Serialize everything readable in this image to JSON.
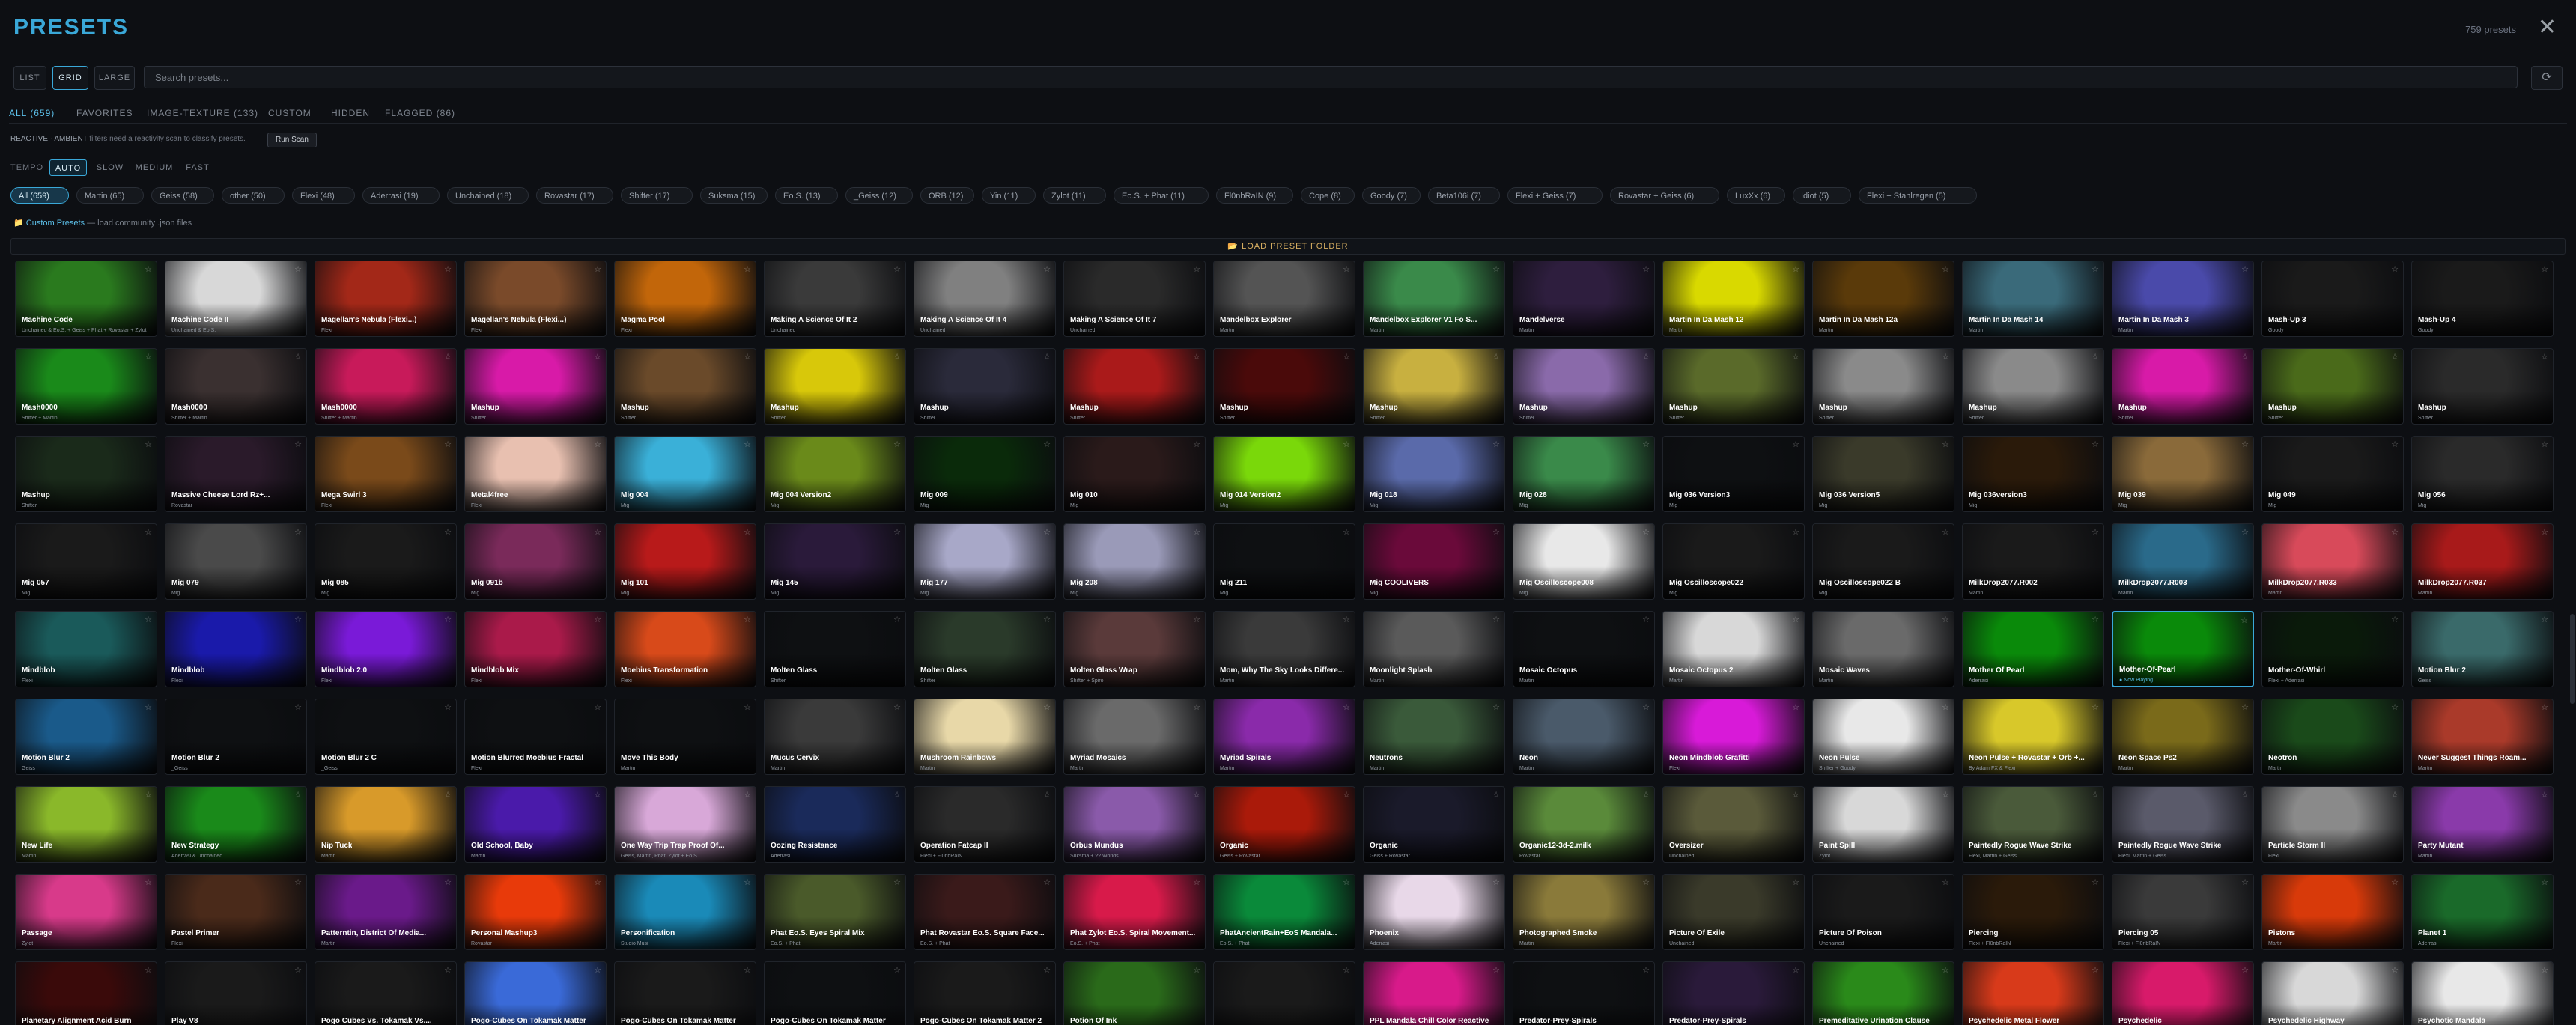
{
  "header": {
    "title": "PRESETS",
    "count": "759 presets",
    "close": "✕"
  },
  "view": {
    "modes": [
      "LIST",
      "GRID",
      "LARGE"
    ],
    "active": "GRID"
  },
  "search": {
    "placeholder": "Search presets..."
  },
  "refresh_icon": "⟳",
  "tabs": [
    "ALL (659)",
    "FAVORITES",
    "IMAGE-TEXTURE (133)",
    "CUSTOM",
    "HIDDEN",
    "FLAGGED (86)"
  ],
  "active_tab": "ALL (659)",
  "reactive": {
    "label": "REACTIVE · AMBIENT",
    "text": "filters need a reactivity scan to classify presets.",
    "button": "Run Scan"
  },
  "tempo": {
    "label": "TEMPO",
    "options": [
      "AUTO",
      "SLOW",
      "MEDIUM",
      "FAST"
    ],
    "active": "AUTO"
  },
  "authors": [
    "All (659)",
    "Martin (65)",
    "Geiss (58)",
    "other (50)",
    "Flexi (48)",
    "Aderrasi (19)",
    "Unchained (18)",
    "Rovastar (17)",
    "Shifter (17)",
    "Suksma (15)",
    "Eo.S. (13)",
    "_Geiss (12)",
    "ORB (12)",
    "Yin (11)",
    "Zylot (11)",
    "Eo.S. + Phat (11)",
    "Fl0nbRaIN (9)",
    "Cope (8)",
    "Goody (7)",
    "Beta106i (7)",
    "Flexi + Geiss (7)",
    "Rovastar + Geiss (6)",
    "LuxXx (6)",
    "Idiot (5)",
    "Flexi + Stahlregen (5)"
  ],
  "custom": {
    "icon": "📁",
    "name": "Custom Presets",
    "hint": "— load community .json files"
  },
  "load_folder": "📂 LOAD PRESET FOLDER",
  "now_playing_label": "● Now Playing",
  "favorite_icon": "☆",
  "tile_colors": [
    "#2a7a1e",
    "#d8d8d8",
    "#a32818",
    "#7a4a2a",
    "#c2660a",
    "#3a3a3a",
    "#808080",
    "#2a2a2a",
    "#545454",
    "#3a8a4a",
    "#2e1e3e",
    "#d9d900",
    "#5a3a0a",
    "#3a6a7a",
    "#4a4aaa",
    "#1a1a1a",
    "#1a1a1a",
    "#1a8a1a",
    "#3a3030",
    "#c81a5a",
    "#d81aa8",
    "#6a4a2a",
    "#d8c80a",
    "#2a2a3a",
    "#aa1a1a",
    "#4a0a0a",
    "#c8b040",
    "#8a6aaa",
    "#5a6a2a",
    "#8a8a8a",
    "#8a8a8a",
    "#d81aa8",
    "#4a6a1a",
    "#2a2a2a",
    "#1a2a1a",
    "#2a1a2a",
    "#7a4a1a",
    "#e8c0b0",
    "#3ab0d8",
    "#6a8a1a",
    "#0a2a0a",
    "#2a1a1a",
    "#7ad80a",
    "#5a6aaa",
    "#3a8a4a",
    "#0e1012",
    "#3a3a2a",
    "#2a1a0a",
    "#8a6a3a",
    "#1a1a1a",
    "#2a2a2a",
    "#1a1a1a",
    "#4a4a4a",
    "#1a1a1a",
    "#7a2a5a",
    "#b81a1a",
    "#2a1a3a",
    "#a8a8c8",
    "#9a9ab8",
    "#0e1012",
    "#6a0a3a",
    "#e8e8e8",
    "#1a1a1a",
    "#1a1a1a",
    "#1a1a1a",
    "#2a6a8a",
    "#d84a5a",
    "#a81a1a",
    "#1a5a5a",
    "#1a1aaa",
    "#7a1ad8",
    "#aa1a4a",
    "#d84a1a",
    "#0e1012",
    "#2a3a2a",
    "#5a3a3a",
    "#3a3a3a",
    "#5a5a5a",
    "#0e1012",
    "#d8d8d8",
    "#6a6a6a",
    "#0a8a0a",
    "#0a8a0a",
    "#0a1a0a",
    "#3a6a6a",
    "#1a5a8a",
    "#0e1012",
    "#0e1012",
    "#0e1012",
    "#0e1012",
    "#3a3a3a",
    "#e8d8a8",
    "#6a6a6a",
    "#8a2aaa",
    "#3a5a3a",
    "#4a5a6a",
    "#d81ad8",
    "#e8e8e8",
    "#d8c82a",
    "#7a6a1a",
    "#1a4a1a",
    "#aa3a2a",
    "#8ab82a",
    "#1a8a1a",
    "#d89a2a",
    "#4a1aaa",
    "#d8a8d8",
    "#1a2a5a",
    "#2a2a2a",
    "#8a5aaa",
    "#aa1a0a",
    "#1a1a2a",
    "#5a8a3a",
    "#5a5a3a",
    "#d8d8d8",
    "#4a5a3a",
    "#5a5a6a",
    "#8a8a8a",
    "#8a3aaa",
    "#d83a8a",
    "#4a2a1a",
    "#6a1a8a",
    "#e83a0a",
    "#1a8ab8",
    "#4a5a2a",
    "#3a1a1a",
    "#d81a4a",
    "#0a8a3a",
    "#e8d8e8",
    "#8a7a3a",
    "#3a3a2a",
    "#1a1a1a",
    "#2a1a0a",
    "#3a3a3a",
    "#d83a0a",
    "#1a6a2a",
    "#3a0a0a",
    "#1a1a1a",
    "#1a1a1a",
    "#3a6ad8",
    "#1a1a1a",
    "#0e1012",
    "#1a1a1a",
    "#2a6a1a",
    "#1a1a1a",
    "#d81a8a",
    "#0e1012",
    "#2a1a3a",
    "#2a8a1a",
    "#d83a1a",
    "#d81a6a",
    "#d8d8d8",
    "#e8e8e8",
    "#d8a8e8",
    "#b8a8c8"
  ],
  "presets": [
    {
      "name": "Machine Code",
      "sub": "Unchained & Eo.S. + Geiss + Phat + Rovastar + Zylot"
    },
    {
      "name": "Machine Code II",
      "sub": "Unchained & Eo.S."
    },
    {
      "name": "Magellan's Nebula (Flexi...)",
      "sub": "Flexi"
    },
    {
      "name": "Magellan's Nebula (Flexi...)",
      "sub": "Flexi"
    },
    {
      "name": "Magma Pool",
      "sub": "Flexi"
    },
    {
      "name": "Making A Science Of It 2",
      "sub": "Unchained"
    },
    {
      "name": "Making A Science Of It 4",
      "sub": "Unchained"
    },
    {
      "name": "Making A Science Of It 7",
      "sub": "Unchained"
    },
    {
      "name": "Mandelbox Explorer",
      "sub": "Martin"
    },
    {
      "name": "Mandelbox Explorer V1 Fo S...",
      "sub": "Martin"
    },
    {
      "name": "Mandelverse",
      "sub": "Martin"
    },
    {
      "name": "Martin In Da Mash 12",
      "sub": "Martin"
    },
    {
      "name": "Martin In Da Mash 12a",
      "sub": "Martin"
    },
    {
      "name": "Martin In Da Mash 14",
      "sub": "Martin"
    },
    {
      "name": "Martin In Da Mash 3",
      "sub": "Martin"
    },
    {
      "name": "Mash-Up 3",
      "sub": "Goody"
    },
    {
      "name": "Mash-Up 4",
      "sub": "Goody"
    },
    {
      "name": "Mash0000",
      "sub": "Shifter + Martin"
    },
    {
      "name": "Mash0000",
      "sub": "Shifter + Martin"
    },
    {
      "name": "Mash0000",
      "sub": "Shifter + Martin"
    },
    {
      "name": "Mashup",
      "sub": "Shifter"
    },
    {
      "name": "Mashup",
      "sub": "Shifter"
    },
    {
      "name": "Mashup",
      "sub": "Shifter"
    },
    {
      "name": "Mashup",
      "sub": "Shifter"
    },
    {
      "name": "Mashup",
      "sub": "Shifter"
    },
    {
      "name": "Mashup",
      "sub": "Shifter"
    },
    {
      "name": "Mashup",
      "sub": "Shifter"
    },
    {
      "name": "Mashup",
      "sub": "Shifter"
    },
    {
      "name": "Mashup",
      "sub": "Shifter"
    },
    {
      "name": "Mashup",
      "sub": "Shifter"
    },
    {
      "name": "Mashup",
      "sub": "Shifter"
    },
    {
      "name": "Mashup",
      "sub": "Shifter"
    },
    {
      "name": "Mashup",
      "sub": "Shifter"
    },
    {
      "name": "Mashup",
      "sub": "Shifter"
    },
    {
      "name": "Mashup",
      "sub": "Shifter"
    },
    {
      "name": "Massive Cheese Lord Rz+...",
      "sub": "Rovastar"
    },
    {
      "name": "Mega Swirl 3",
      "sub": "Flexi"
    },
    {
      "name": "Metal4free",
      "sub": "Flexi"
    },
    {
      "name": "Mig 004",
      "sub": "Mig"
    },
    {
      "name": "Mig 004 Version2",
      "sub": "Mig"
    },
    {
      "name": "Mig 009",
      "sub": "Mig"
    },
    {
      "name": "Mig 010",
      "sub": "Mig"
    },
    {
      "name": "Mig 014 Version2",
      "sub": "Mig"
    },
    {
      "name": "Mig 018",
      "sub": "Mig"
    },
    {
      "name": "Mig 028",
      "sub": "Mig"
    },
    {
      "name": "Mig 036 Version3",
      "sub": "Mig"
    },
    {
      "name": "Mig 036 Version5",
      "sub": "Mig"
    },
    {
      "name": "Mig 036version3",
      "sub": "Mig"
    },
    {
      "name": "Mig 039",
      "sub": "Mig"
    },
    {
      "name": "Mig 049",
      "sub": "Mig"
    },
    {
      "name": "Mig 056",
      "sub": "Mig"
    },
    {
      "name": "Mig 057",
      "sub": "Mig"
    },
    {
      "name": "Mig 079",
      "sub": "Mig"
    },
    {
      "name": "Mig 085",
      "sub": "Mig"
    },
    {
      "name": "Mig 091b",
      "sub": "Mig"
    },
    {
      "name": "Mig 101",
      "sub": "Mig"
    },
    {
      "name": "Mig 145",
      "sub": "Mig"
    },
    {
      "name": "Mig 177",
      "sub": "Mig"
    },
    {
      "name": "Mig 208",
      "sub": "Mig"
    },
    {
      "name": "Mig 211",
      "sub": "Mig"
    },
    {
      "name": "Mig COOLIVERS",
      "sub": "Mig"
    },
    {
      "name": "Mig Oscilloscope008",
      "sub": "Mig"
    },
    {
      "name": "Mig Oscilloscope022",
      "sub": "Mig"
    },
    {
      "name": "Mig Oscilloscope022 B",
      "sub": "Mig"
    },
    {
      "name": "MilkDrop2077.R002",
      "sub": "Martin"
    },
    {
      "name": "MilkDrop2077.R003",
      "sub": "Martin"
    },
    {
      "name": "MilkDrop2077.R033",
      "sub": "Martin"
    },
    {
      "name": "MilkDrop2077.R037",
      "sub": "Martin"
    },
    {
      "name": "Mindblob",
      "sub": "Flexi"
    },
    {
      "name": "Mindblob",
      "sub": "Flexi"
    },
    {
      "name": "Mindblob 2.0",
      "sub": "Flexi"
    },
    {
      "name": "Mindblob Mix",
      "sub": "Flexi"
    },
    {
      "name": "Moebius Transformation",
      "sub": "Flexi"
    },
    {
      "name": "Molten Glass",
      "sub": "Shifter"
    },
    {
      "name": "Molten Glass",
      "sub": "Shifter"
    },
    {
      "name": "Molten Glass Wrap",
      "sub": "Shifter + Spiro"
    },
    {
      "name": "Mom, Why The Sky Looks Differe...",
      "sub": "Martin"
    },
    {
      "name": "Moonlight Splash",
      "sub": "Martin"
    },
    {
      "name": "Mosaic Octopus",
      "sub": "Martin"
    },
    {
      "name": "Mosaic Octopus 2",
      "sub": "Martin"
    },
    {
      "name": "Mosaic Waves",
      "sub": "Martin"
    },
    {
      "name": "Mother Of Pearl",
      "sub": "Aderrasi"
    },
    {
      "name": "Mother-Of-Pearl",
      "sub": "Aderrasi"
    },
    {
      "name": "Mother-Of-Whirl",
      "sub": "Flexi + Aderrasi"
    },
    {
      "name": "Motion Blur 2",
      "sub": "Geiss"
    },
    {
      "name": "Motion Blur 2",
      "sub": "Geiss"
    },
    {
      "name": "Motion Blur 2",
      "sub": "_Geiss"
    },
    {
      "name": "Motion Blur 2 C",
      "sub": "_Geiss"
    },
    {
      "name": "Motion Blurred Moebius Fractal",
      "sub": "Flexi"
    },
    {
      "name": "Move This Body",
      "sub": "Martin"
    },
    {
      "name": "Mucus Cervix",
      "sub": "Martin"
    },
    {
      "name": "Mushroom Rainbows",
      "sub": "Martin"
    },
    {
      "name": "Myriad Mosaics",
      "sub": "Martin"
    },
    {
      "name": "Myriad Spirals",
      "sub": "Martin"
    },
    {
      "name": "Neutrons",
      "sub": "Martin"
    },
    {
      "name": "Neon",
      "sub": "Martin"
    },
    {
      "name": "Neon Mindblob Grafitti",
      "sub": "Flexi"
    },
    {
      "name": "Neon Pulse",
      "sub": "Shifter + Goody"
    },
    {
      "name": "Neon Pulse + Rovastar + Orb +...",
      "sub": "By Adam FX & Flexi"
    },
    {
      "name": "Neon Space Ps2",
      "sub": "Martin"
    },
    {
      "name": "Neotron",
      "sub": "Martin"
    },
    {
      "name": "Never Suggest Things Roam...",
      "sub": "Martin"
    },
    {
      "name": "New Life",
      "sub": "Martin"
    },
    {
      "name": "New Strategy",
      "sub": "Aderrasi & Unchained"
    },
    {
      "name": "Nip Tuck",
      "sub": "Martin"
    },
    {
      "name": "Old School, Baby",
      "sub": "Martin"
    },
    {
      "name": "One Way Trip Trap Proof Of...",
      "sub": "Geiss, Martin, Phat, Zylot + Eo.S."
    },
    {
      "name": "Oozing Resistance",
      "sub": "Aderrasi"
    },
    {
      "name": "Operation Fatcap II",
      "sub": "Flexi + Fl0nbRaIN"
    },
    {
      "name": "Orbus Mundus",
      "sub": "Suksma + ?? Worlds"
    },
    {
      "name": "Organic",
      "sub": "Geiss + Rovastar"
    },
    {
      "name": "Organic",
      "sub": "Geiss + Rovastar"
    },
    {
      "name": "Organic12-3d-2.milk",
      "sub": "Rovastar"
    },
    {
      "name": "Oversizer",
      "sub": "Unchained"
    },
    {
      "name": "Paint Spill",
      "sub": "Zylot"
    },
    {
      "name": "Paintedly Rogue Wave Strike",
      "sub": "Flexi, Martin + Geiss"
    },
    {
      "name": "Paintedly Rogue Wave Strike",
      "sub": "Flexi, Martin + Geiss"
    },
    {
      "name": "Particle Storm II",
      "sub": "Flexi"
    },
    {
      "name": "Party Mutant",
      "sub": "Martin"
    },
    {
      "name": "Passage",
      "sub": "Zylot"
    },
    {
      "name": "Pastel Primer",
      "sub": "Flexi"
    },
    {
      "name": "Patterntin, District Of Media...",
      "sub": "Martin"
    },
    {
      "name": "Personal Mashup3",
      "sub": "Rovastar"
    },
    {
      "name": "Personification",
      "sub": "Studio Musi"
    },
    {
      "name": "Phat Eo.S. Eyes Spiral Mix",
      "sub": "Eo.S. + Phat"
    },
    {
      "name": "Phat Rovastar Eo.S. Square Face...",
      "sub": "Eo.S. + Phat"
    },
    {
      "name": "Phat Zylot Eo.S. Spiral Movement...",
      "sub": "Eo.S. + Phat"
    },
    {
      "name": "PhatAncientRain+EoS Mandala...",
      "sub": "Eo.S. + Phat"
    },
    {
      "name": "Phoenix",
      "sub": "Aderrasi"
    },
    {
      "name": "Photographed Smoke",
      "sub": "Martin"
    },
    {
      "name": "Picture Of Exile",
      "sub": "Unchained"
    },
    {
      "name": "Picture Of Poison",
      "sub": "Unchained"
    },
    {
      "name": "Piercing",
      "sub": "Flexi + Fl0nbRaIN"
    },
    {
      "name": "Piercing 05",
      "sub": "Flexi + Fl0nbRaIN"
    },
    {
      "name": "Pistons",
      "sub": "Martin"
    },
    {
      "name": "Planet 1",
      "sub": "Aderrasi"
    },
    {
      "name": "Planetary Alignment Acid Burn",
      "sub": "Rovastar"
    },
    {
      "name": "Play V8",
      "sub": "Eo.S."
    },
    {
      "name": "Pogo Cubes Vs. Tokamak Vs....",
      "sub": "Flexi"
    },
    {
      "name": "Pogo-Cubes On Tokamak Matter",
      "sub": "Flexi"
    },
    {
      "name": "Pogo-Cubes On Tokamak Matter",
      "sub": "Flexi"
    },
    {
      "name": "Pogo-Cubes On Tokamak Matter",
      "sub": "Flexi"
    },
    {
      "name": "Pogo-Cubes On Tokamak Matter 2",
      "sub": "Flexi"
    },
    {
      "name": "Potion Of Ink",
      "sub": "Martin"
    },
    {
      "name": "",
      "sub": ""
    },
    {
      "name": "PPL Mandala Chill Color Reactive",
      "sub": "Phat"
    },
    {
      "name": "Predator-Prey-Spirals",
      "sub": "Geiss"
    },
    {
      "name": "Predator-Prey-Spirals",
      "sub": "Geiss"
    },
    {
      "name": "Premeditative Urination Clause",
      "sub": "Flexi"
    },
    {
      "name": "Psychedelic Metal Flower",
      "sub": "Martin"
    },
    {
      "name": "Psychedelic",
      "sub": "Martin"
    },
    {
      "name": "Psychedelic Highway",
      "sub": "Martin"
    },
    {
      "name": "Psychotic Mandala",
      "sub": "Martin"
    }
  ],
  "now_playing_index": 82
}
